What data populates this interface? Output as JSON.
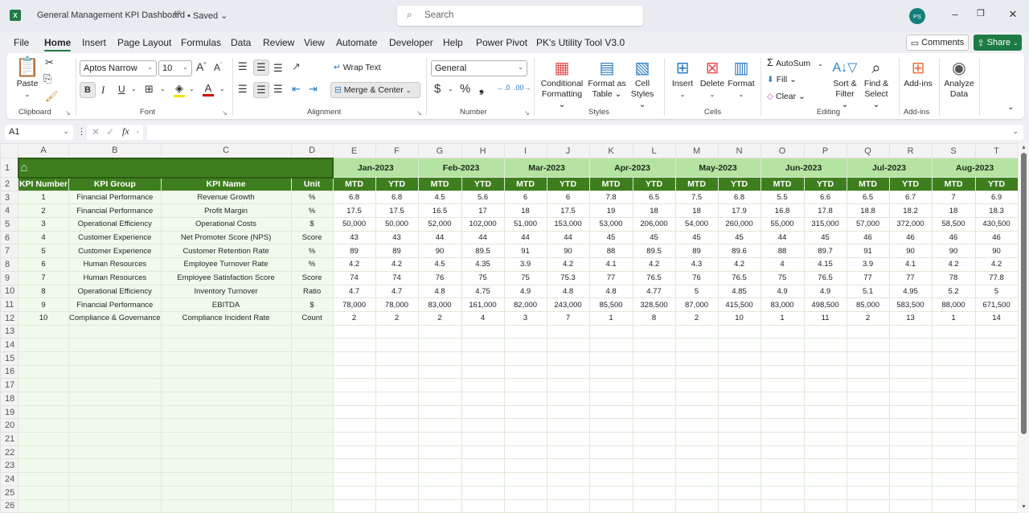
{
  "titlebar": {
    "app_icon": "excel-icon",
    "app_icon_text": "X",
    "doc_title": "General Management KPI Dashboard",
    "share_icon": "people-icon",
    "saved_status": "• Saved ⌄",
    "search_placeholder": "Search",
    "avatar_initials": "PS",
    "minimize": "–",
    "restore": "❐",
    "close": "✕"
  },
  "menu": {
    "items": [
      "File",
      "Home",
      "Insert",
      "Page Layout",
      "Formulas",
      "Data",
      "Review",
      "View",
      "Automate",
      "Developer",
      "Help",
      "Power Pivot",
      "PK's Utility Tool V3.0"
    ],
    "active": "Home",
    "comments_label": "Comments",
    "share_label": "Share"
  },
  "ribbon": {
    "clipboard": {
      "label": "Clipboard",
      "paste": "Paste"
    },
    "font": {
      "label": "Font",
      "font_name": "Aptos Narrow",
      "font_size": "10",
      "bold": "B",
      "italic": "I",
      "underline": "U"
    },
    "alignment": {
      "label": "Alignment",
      "wrap_text": "Wrap Text",
      "merge_center": "Merge & Center"
    },
    "number": {
      "label": "Number",
      "format": "General",
      "currency": "$",
      "percent": "%",
      "comma": "❟"
    },
    "styles": {
      "label": "Styles",
      "conditional_formatting": [
        "Conditional",
        "Formatting ⌄"
      ],
      "format_as_table": [
        "Format as",
        "Table ⌄"
      ],
      "cell_styles": [
        "Cell",
        "Styles ⌄"
      ]
    },
    "cells": {
      "label": "Cells",
      "insert": "Insert",
      "delete": "Delete",
      "format": "Format"
    },
    "editing": {
      "label": "Editing",
      "autosum": "AutoSum",
      "fill": "Fill ⌄",
      "clear": "Clear ⌄",
      "sort_filter": [
        "Sort &",
        "Filter ⌄"
      ],
      "find_select": [
        "Find &",
        "Select ⌄"
      ]
    },
    "addins": {
      "label": "Add-ins",
      "addins_btn": "Add-ins"
    },
    "analyze": {
      "label": [
        "Analyze",
        "Data"
      ]
    }
  },
  "formula_bar": {
    "name_box": "A1",
    "fx": "fx",
    "formula": ""
  },
  "sheet": {
    "columns": [
      "A",
      "B",
      "C",
      "D",
      "E",
      "F",
      "G",
      "H",
      "I",
      "J",
      "K",
      "L",
      "M",
      "N",
      "O",
      "P",
      "Q",
      "R",
      "S",
      "T"
    ],
    "row_numbers": [
      "1",
      "2",
      "3",
      "4",
      "5",
      "6",
      "7",
      "8",
      "9",
      "10",
      "11",
      "12",
      "13",
      "14",
      "15",
      "16",
      "17",
      "18",
      "19",
      "20",
      "21",
      "22",
      "23",
      "24",
      "25",
      "26"
    ],
    "banner_icon": "home-icon",
    "headers": [
      "KPI Number",
      "KPI Group",
      "KPI Name",
      "Unit"
    ],
    "months": [
      "Jan-2023",
      "Feb-2023",
      "Mar-2023",
      "Apr-2023",
      "May-2023",
      "Jun-2023",
      "Jul-2023",
      "Aug-2023"
    ],
    "sub_headers": [
      "MTD",
      "YTD"
    ],
    "rows": [
      {
        "num": "1",
        "group": "Financial Performance",
        "name": "Revenue Growth",
        "unit": "%",
        "values": [
          "6.8",
          "6.8",
          "4.5",
          "5.6",
          "6",
          "6",
          "7.8",
          "6.5",
          "7.5",
          "6.8",
          "5.5",
          "6.6",
          "6.5",
          "6.7",
          "7",
          "6.9"
        ]
      },
      {
        "num": "2",
        "group": "Financial Performance",
        "name": "Profit Margin",
        "unit": "%",
        "values": [
          "17.5",
          "17.5",
          "16.5",
          "17",
          "18",
          "17.5",
          "19",
          "18",
          "18",
          "17.9",
          "16.8",
          "17.8",
          "18.8",
          "18.2",
          "18",
          "18.3"
        ]
      },
      {
        "num": "3",
        "group": "Operational Efficiency",
        "name": "Operational Costs",
        "unit": "$",
        "values": [
          "50,000",
          "50,000",
          "52,000",
          "102,000",
          "51,000",
          "153,000",
          "53,000",
          "206,000",
          "54,000",
          "260,000",
          "55,000",
          "315,000",
          "57,000",
          "372,000",
          "58,500",
          "430,500"
        ]
      },
      {
        "num": "4",
        "group": "Customer Experience",
        "name": "Net Promoter Score (NPS)",
        "unit": "Score",
        "values": [
          "43",
          "43",
          "44",
          "44",
          "44",
          "44",
          "45",
          "45",
          "45",
          "45",
          "44",
          "45",
          "46",
          "46",
          "46",
          "46"
        ]
      },
      {
        "num": "5",
        "group": "Customer Experience",
        "name": "Customer Retention Rate",
        "unit": "%",
        "values": [
          "89",
          "89",
          "90",
          "89.5",
          "91",
          "90",
          "88",
          "89.5",
          "89",
          "89.6",
          "88",
          "89.7",
          "91",
          "90",
          "90",
          "90"
        ]
      },
      {
        "num": "6",
        "group": "Human Resources",
        "name": "Employee Turnover Rate",
        "unit": "%",
        "values": [
          "4.2",
          "4.2",
          "4.5",
          "4.35",
          "3.9",
          "4.2",
          "4.1",
          "4.2",
          "4.3",
          "4.2",
          "4",
          "4.15",
          "3.9",
          "4.1",
          "4.2",
          "4.2"
        ]
      },
      {
        "num": "7",
        "group": "Human Resources",
        "name": "Employee Satisfaction Score",
        "unit": "Score",
        "values": [
          "74",
          "74",
          "76",
          "75",
          "75",
          "75.3",
          "77",
          "76.5",
          "76",
          "76.5",
          "75",
          "76.5",
          "77",
          "77",
          "78",
          "77.8"
        ]
      },
      {
        "num": "8",
        "group": "Operational Efficiency",
        "name": "Inventory Turnover",
        "unit": "Ratio",
        "values": [
          "4.7",
          "4.7",
          "4.8",
          "4.75",
          "4.9",
          "4.8",
          "4.8",
          "4.77",
          "5",
          "4.85",
          "4.9",
          "4.9",
          "5.1",
          "4.95",
          "5.2",
          "5"
        ]
      },
      {
        "num": "9",
        "group": "Financial Performance",
        "name": "EBITDA",
        "unit": "$",
        "values": [
          "78,000",
          "78,000",
          "83,000",
          "161,000",
          "82,000",
          "243,000",
          "85,500",
          "328,500",
          "87,000",
          "415,500",
          "83,000",
          "498,500",
          "85,000",
          "583,500",
          "88,000",
          "671,500"
        ]
      },
      {
        "num": "10",
        "group": "Compliance & Governance",
        "name": "Compliance Incident Rate",
        "unit": "Count",
        "values": [
          "2",
          "2",
          "2",
          "4",
          "3",
          "7",
          "1",
          "8",
          "2",
          "10",
          "1",
          "11",
          "2",
          "13",
          "1",
          "14"
        ]
      }
    ]
  },
  "colors": {
    "brand_green": "#1e7b45",
    "header_green": "#3f7e1f",
    "month_green": "#b5e3a1",
    "band_green": "#f0faec"
  }
}
